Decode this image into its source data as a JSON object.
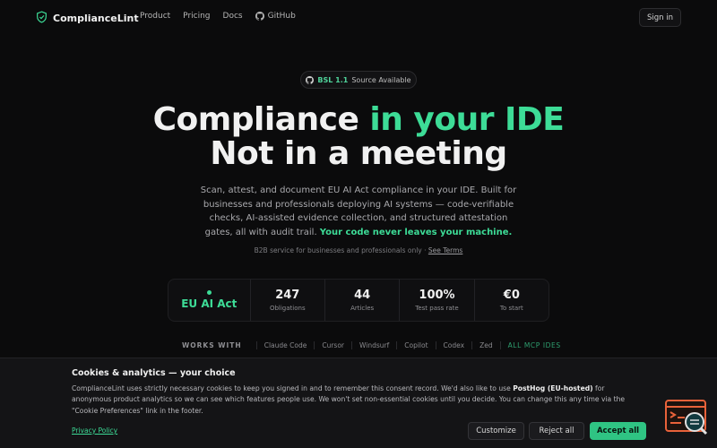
{
  "nav": {
    "brand": "ComplianceLint",
    "links": [
      "Product",
      "Pricing",
      "Docs",
      "GitHub"
    ],
    "sign_in": "Sign in"
  },
  "badge": {
    "license": "BSL 1.1",
    "text": "Source Available"
  },
  "hero": {
    "line1_a": "Compliance ",
    "line1_b": "in your IDE",
    "line2": "Not in a meeting",
    "description": "Scan, attest, and document EU AI Act compliance in your IDE. Built for businesses and professionals deploying AI systems — code-verifiable checks, AI-assisted evidence collection, and structured attestation gates, all with audit trail. ",
    "description_highlight": "Your code never leaves your machine.",
    "b2b": "B2B service for businesses and professionals only · ",
    "b2b_link": "See Terms"
  },
  "stats": {
    "framework": "EU AI Act",
    "items": [
      {
        "value": "247",
        "label": "Obligations"
      },
      {
        "value": "44",
        "label": "Articles"
      },
      {
        "value": "100%",
        "label": "Test pass rate"
      },
      {
        "value": "€0",
        "label": "To start"
      }
    ]
  },
  "works_with": {
    "label": "WORKS WITH",
    "tools": [
      "Claude Code",
      "Cursor",
      "Windsurf",
      "Copilot",
      "Codex",
      "Zed"
    ],
    "all": "ALL MCP IDES"
  },
  "cookie": {
    "title": "Cookies & analytics — your choice",
    "body_a": "ComplianceLint uses strictly necessary cookies to keep you signed in and to remember this consent record. We'd also like to use ",
    "body_bold": "PostHog (EU-hosted)",
    "body_b": " for anonymous product analytics so we can see which features people use. We won't set non-essential cookies until you decide. You can change this any time via the \"Cookie Preferences\" link in the footer.",
    "privacy": "Privacy Policy",
    "customize": "Customize",
    "reject": "Reject all",
    "accept": "Accept all"
  },
  "colors": {
    "accent": "#3ddc97",
    "background": "#0b0b0c",
    "widget": "#e8623a"
  }
}
